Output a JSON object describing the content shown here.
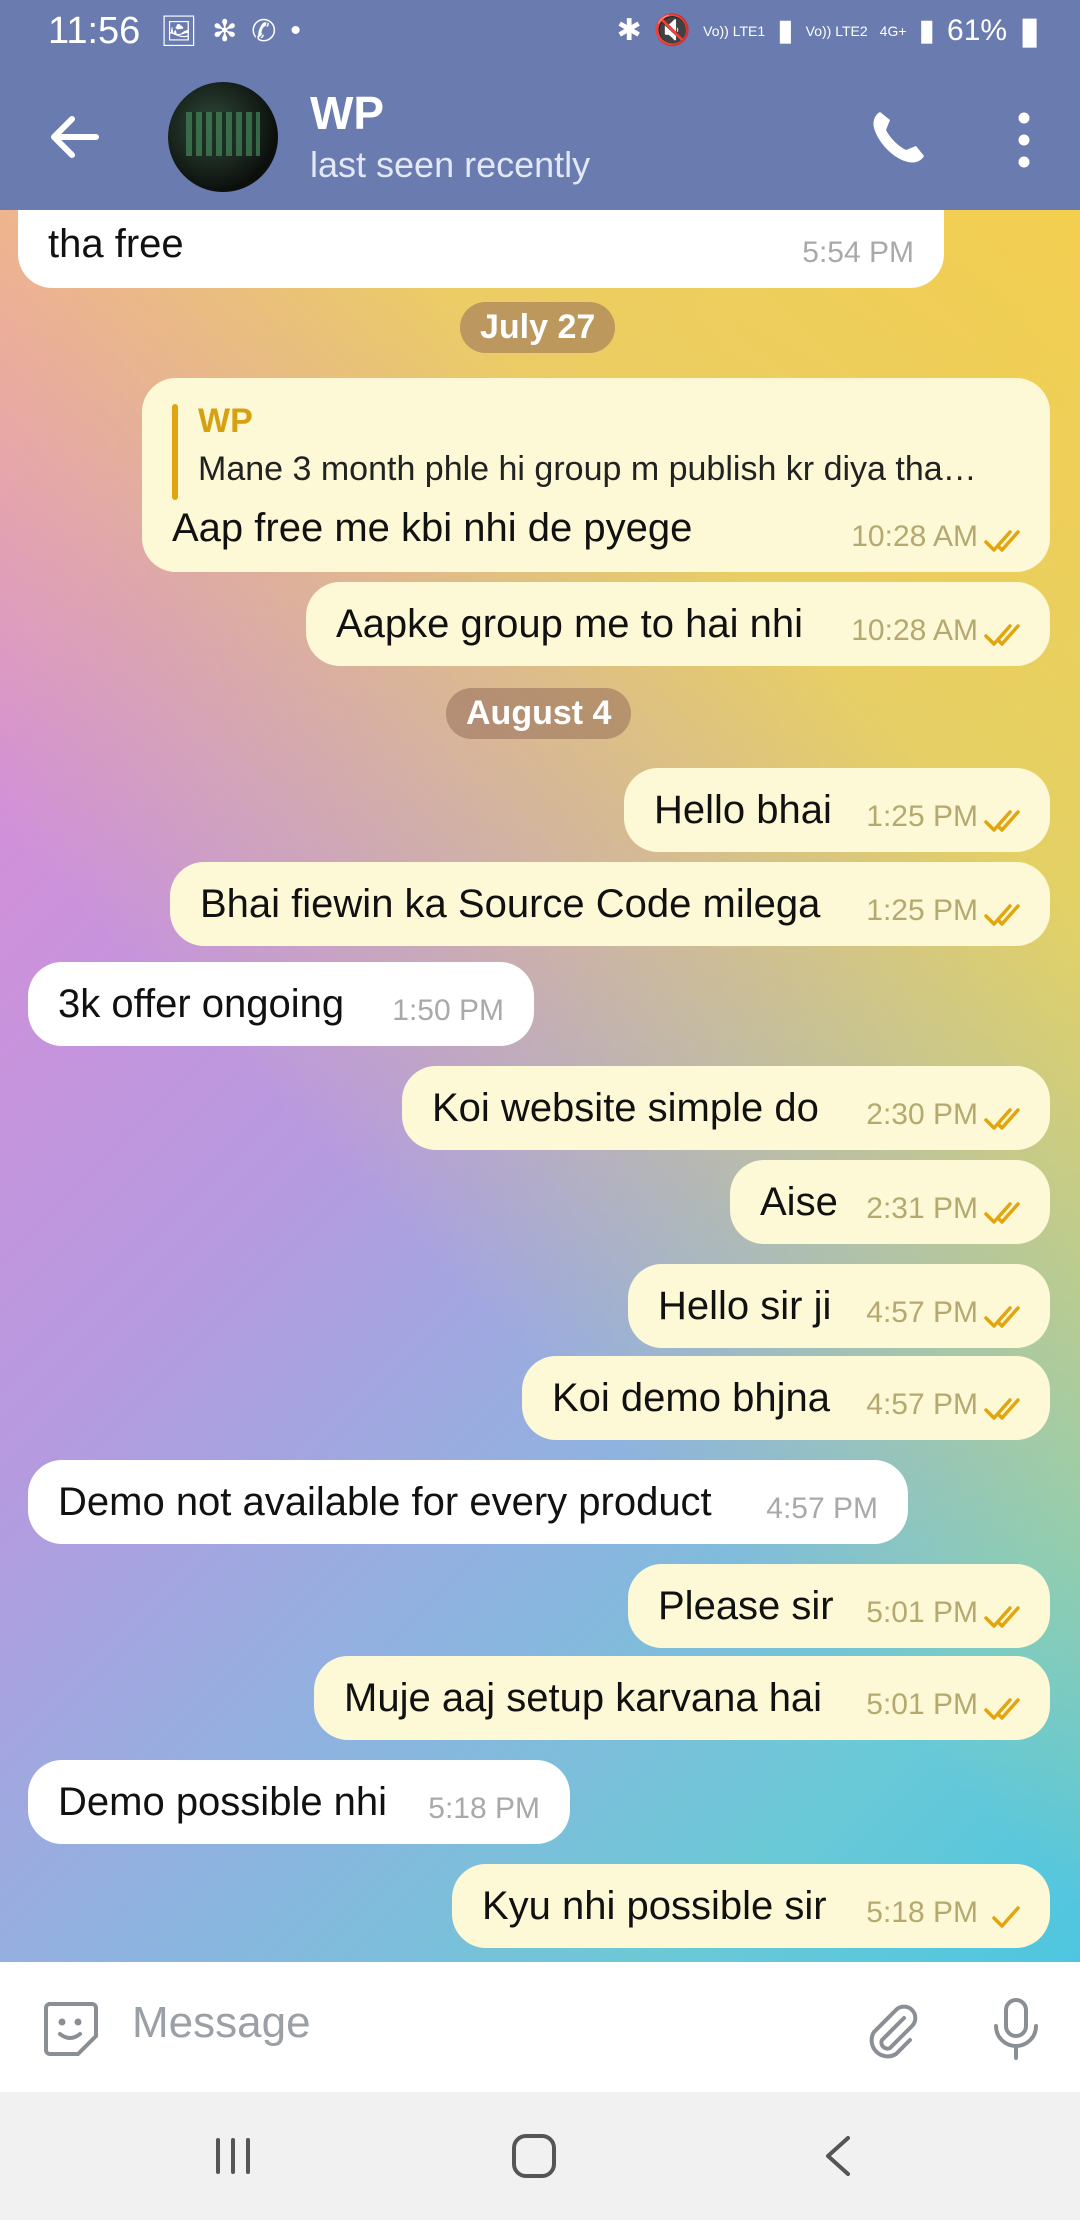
{
  "status_bar": {
    "time": "11:56",
    "left_icons": [
      "image-icon",
      "pinwheel-icon",
      "whatsapp-icon",
      "dot-icon"
    ],
    "volte1": "Vo)) LTE1",
    "volte2": "Vo)) LTE2",
    "network": "4G+",
    "battery": "61%"
  },
  "header": {
    "contact_name": "WP",
    "status": "last seen recently"
  },
  "dates": {
    "july": "July 27",
    "august": "August 4"
  },
  "messages": [
    {
      "dir": "in",
      "text": "tha free",
      "time": "5:54 PM"
    },
    {
      "dir": "out",
      "reply_name": "WP",
      "reply_text": "Mane 3 month phle hi group m publish kr diya tha…",
      "text": "Aap free me kbi nhi de pyege",
      "time": "10:28 AM",
      "status": "read"
    },
    {
      "dir": "out",
      "text": "Aapke group me to hai nhi",
      "time": "10:28 AM",
      "status": "read"
    },
    {
      "dir": "out",
      "text": "Hello bhai",
      "time": "1:25 PM",
      "status": "read"
    },
    {
      "dir": "out",
      "text": "Bhai fiewin ka Source Code milega",
      "time": "1:25 PM",
      "status": "read"
    },
    {
      "dir": "in",
      "text": "3k offer ongoing",
      "time": "1:50 PM"
    },
    {
      "dir": "out",
      "text": "Koi website simple do",
      "time": "2:30 PM",
      "status": "read"
    },
    {
      "dir": "out",
      "text": "Aise",
      "time": "2:31 PM",
      "status": "read"
    },
    {
      "dir": "out",
      "text": "Hello sir ji",
      "time": "4:57 PM",
      "status": "read"
    },
    {
      "dir": "out",
      "text": "Koi demo bhjna",
      "time": "4:57 PM",
      "status": "read"
    },
    {
      "dir": "in",
      "text": "Demo not available for every product",
      "time": "4:57 PM"
    },
    {
      "dir": "out",
      "text": "Please sir",
      "time": "5:01 PM",
      "status": "read"
    },
    {
      "dir": "out",
      "text": "Muje aaj setup karvana hai",
      "time": "5:01 PM",
      "status": "read"
    },
    {
      "dir": "in",
      "text": "Demo possible nhi",
      "time": "5:18 PM"
    },
    {
      "dir": "out",
      "text": "Kyu nhi possible sir",
      "time": "5:18 PM",
      "status": "sent"
    }
  ],
  "input": {
    "placeholder": "Message"
  },
  "colors": {
    "header": "#6a7bb0",
    "outgoing_bubble": "#fdf8d5",
    "incoming_bubble": "#ffffff",
    "tick": "#e0a510",
    "reply_accent": "#d6a010"
  }
}
